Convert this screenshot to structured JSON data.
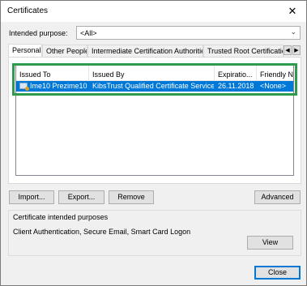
{
  "window": {
    "title": "Certificates",
    "close_glyph": "✕"
  },
  "purpose": {
    "label": "Intended purpose:",
    "value": "<All>",
    "chevron": "⌄"
  },
  "tabs": [
    {
      "label": "Personal",
      "active": true
    },
    {
      "label": "Other People",
      "active": false
    },
    {
      "label": "Intermediate Certification Authorities",
      "active": false
    },
    {
      "label": "Trusted Root Certification",
      "active": false
    }
  ],
  "tab_scroll": {
    "left": "◀",
    "right": "▶"
  },
  "list": {
    "columns": [
      "Issued To",
      "Issued By",
      "Expiratio...",
      "Friendly Na"
    ],
    "rows": [
      {
        "issued_to": "Ime10 Prezime10",
        "issued_by": "KibsTrust Qualified Certificate Services",
        "expiration": "26.11.2018",
        "friendly_name": "<None>",
        "selected": true
      }
    ]
  },
  "buttons": {
    "import": "Import...",
    "export": "Export...",
    "remove": "Remove",
    "advanced": "Advanced",
    "view": "View",
    "close": "Close"
  },
  "purposes_group": {
    "title": "Certificate intended purposes",
    "text": "Client Authentication, Secure Email, Smart Card Logon"
  },
  "colors": {
    "selection": "#0078d7",
    "highlight_frame": "#2e9a4c",
    "dialog_bg": "#f0f0f0"
  }
}
